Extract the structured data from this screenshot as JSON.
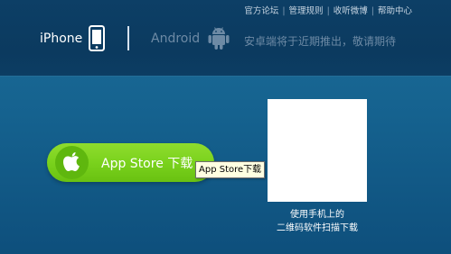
{
  "header": {
    "top_links": [
      "官方论坛",
      "管理规则",
      "收听微博",
      "帮助中心"
    ],
    "iphone_label": "iPhone",
    "android_label": "Android",
    "android_note": "安卓端将于近期推出，敬请期待"
  },
  "main": {
    "appstore_button_label": "App Store  下载",
    "tooltip": "App Store下载",
    "qr_caption_line1": "使用手机上的",
    "qr_caption_line2": "二维码软件扫描下载"
  },
  "icons": {
    "phone": "phone-icon",
    "android": "android-icon",
    "apple": "apple-icon"
  },
  "colors": {
    "accent_green": "#7ad21d",
    "header_bg": "#0b3a5f",
    "page_bg": "#15628f",
    "disabled_text": "#6d8aa5"
  }
}
